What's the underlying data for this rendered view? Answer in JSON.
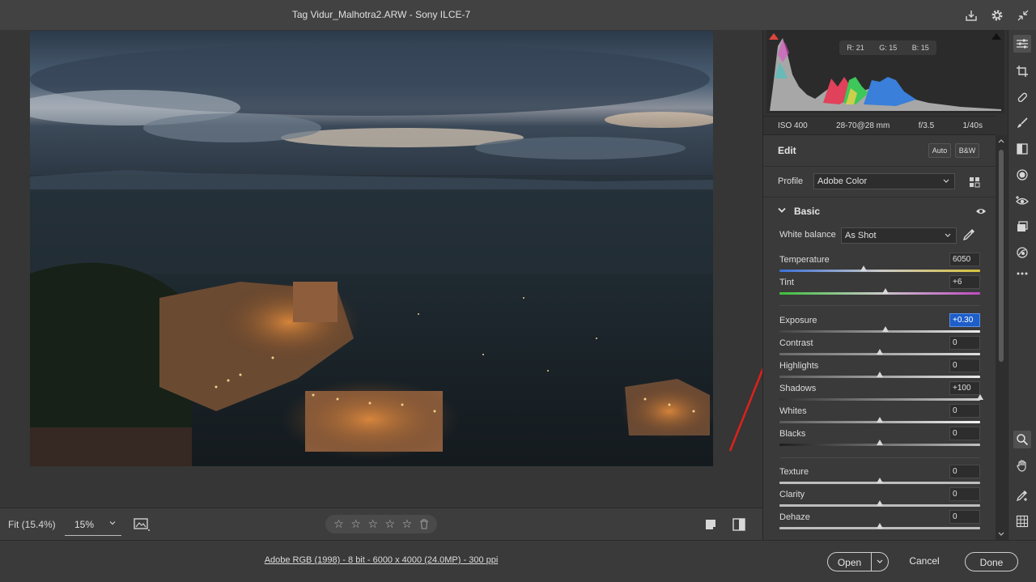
{
  "window": {
    "title": "Tag Vidur_Malhotra2.ARW  -  Sony ILCE-7"
  },
  "histogram": {
    "r_label": "R: 21",
    "g_label": "G: 15",
    "b_label": "B: 15"
  },
  "camera_info": {
    "iso": "ISO 400",
    "lens": "28-70@28 mm",
    "aperture": "f/3.5",
    "shutter": "1/40s"
  },
  "edit": {
    "title": "Edit",
    "auto_label": "Auto",
    "bw_label": "B&W",
    "profile_label": "Profile",
    "profile_value": "Adobe Color",
    "basic_title": "Basic",
    "white_balance_label": "White balance",
    "white_balance_value": "As Shot",
    "sliders": {
      "temperature": {
        "label": "Temperature",
        "value": "6050",
        "position": 0.42
      },
      "tint": {
        "label": "Tint",
        "value": "+6",
        "position": 0.53
      },
      "exposure": {
        "label": "Exposure",
        "value": "+0.30",
        "position": 0.53
      },
      "contrast": {
        "label": "Contrast",
        "value": "0",
        "position": 0.5
      },
      "highlights": {
        "label": "Highlights",
        "value": "0",
        "position": 0.5
      },
      "shadows": {
        "label": "Shadows",
        "value": "+100",
        "position": 1.0
      },
      "whites": {
        "label": "Whites",
        "value": "0",
        "position": 0.5
      },
      "blacks": {
        "label": "Blacks",
        "value": "0",
        "position": 0.5
      },
      "texture": {
        "label": "Texture",
        "value": "0",
        "position": 0.5
      },
      "clarity": {
        "label": "Clarity",
        "value": "0",
        "position": 0.5
      },
      "dehaze": {
        "label": "Dehaze",
        "value": "0",
        "position": 0.5
      }
    }
  },
  "canvas_toolbar": {
    "fit_label": "Fit (15.4%)",
    "zoom_value": "15%",
    "rating_stars": 0
  },
  "status": {
    "workflow_link": "Adobe RGB (1998) - 8 bit - 6000 x 4000 (24.0MP) - 300 ppi",
    "open_label": "Open",
    "cancel_label": "Cancel",
    "done_label": "Done"
  },
  "colors": {
    "accent_blue": "#1d5ec9",
    "clip_warning": "#e0453c",
    "annotation_arrow": "#e0201c"
  },
  "icons": [
    "export-icon",
    "gear-icon",
    "minimize-icon",
    "edit-sliders-icon",
    "crop-icon",
    "healing-icon",
    "brush-icon",
    "gradient-icon",
    "radial-icon",
    "redeye-icon",
    "snapshots-icon",
    "presets-icon",
    "more-icon",
    "zoom-icon",
    "hand-icon",
    "sampler-icon",
    "grid-overlay-icon"
  ]
}
